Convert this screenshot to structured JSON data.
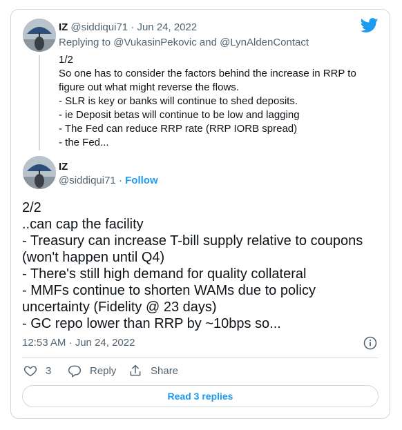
{
  "reply_tweet": {
    "display_name": "IZ",
    "handle": "@siddiqui71",
    "separator": "·",
    "date": "Jun 24, 2022",
    "replying_to": "Replying to @VukasinPekovic and @LynAldenContact",
    "lines": [
      "1/2",
      "So one has to consider the factors behind the increase in RRP to",
      "figure out what might reverse the flows.",
      "- SLR is key or banks will continue to shed deposits.",
      "- ie Deposit betas will continue to be low and lagging",
      "- The Fed can reduce RRP rate (RRP IORB spread)",
      "- the Fed..."
    ]
  },
  "main_tweet": {
    "display_name": "IZ",
    "handle": "@siddiqui71",
    "separator": "·",
    "follow_label": "Follow",
    "lines": [
      "2/2",
      "..can cap the facility",
      "- Treasury can increase T-bill supply relative to coupons",
      "(won't happen until Q4)",
      "- There's still high demand for quality collateral",
      "- MMFs continue to shorten WAMs due to policy",
      "uncertainty (Fidelity @ 23 days)",
      "- GC repo lower than RRP by ~10bps so..."
    ],
    "timestamp": "12:53 AM · Jun 24, 2022"
  },
  "actions": {
    "like_count": "3",
    "reply_label": "Reply",
    "share_label": "Share"
  },
  "read_replies_label": "Read 3 replies",
  "icons": {
    "logo": "twitter-bird-icon",
    "info": "info-icon",
    "like": "heart-icon",
    "reply": "comment-bubble-icon",
    "share": "share-upload-icon"
  },
  "colors": {
    "accent": "#1d9bf0",
    "text": "#0f1419",
    "muted": "#536471",
    "border": "#cfd9de"
  }
}
